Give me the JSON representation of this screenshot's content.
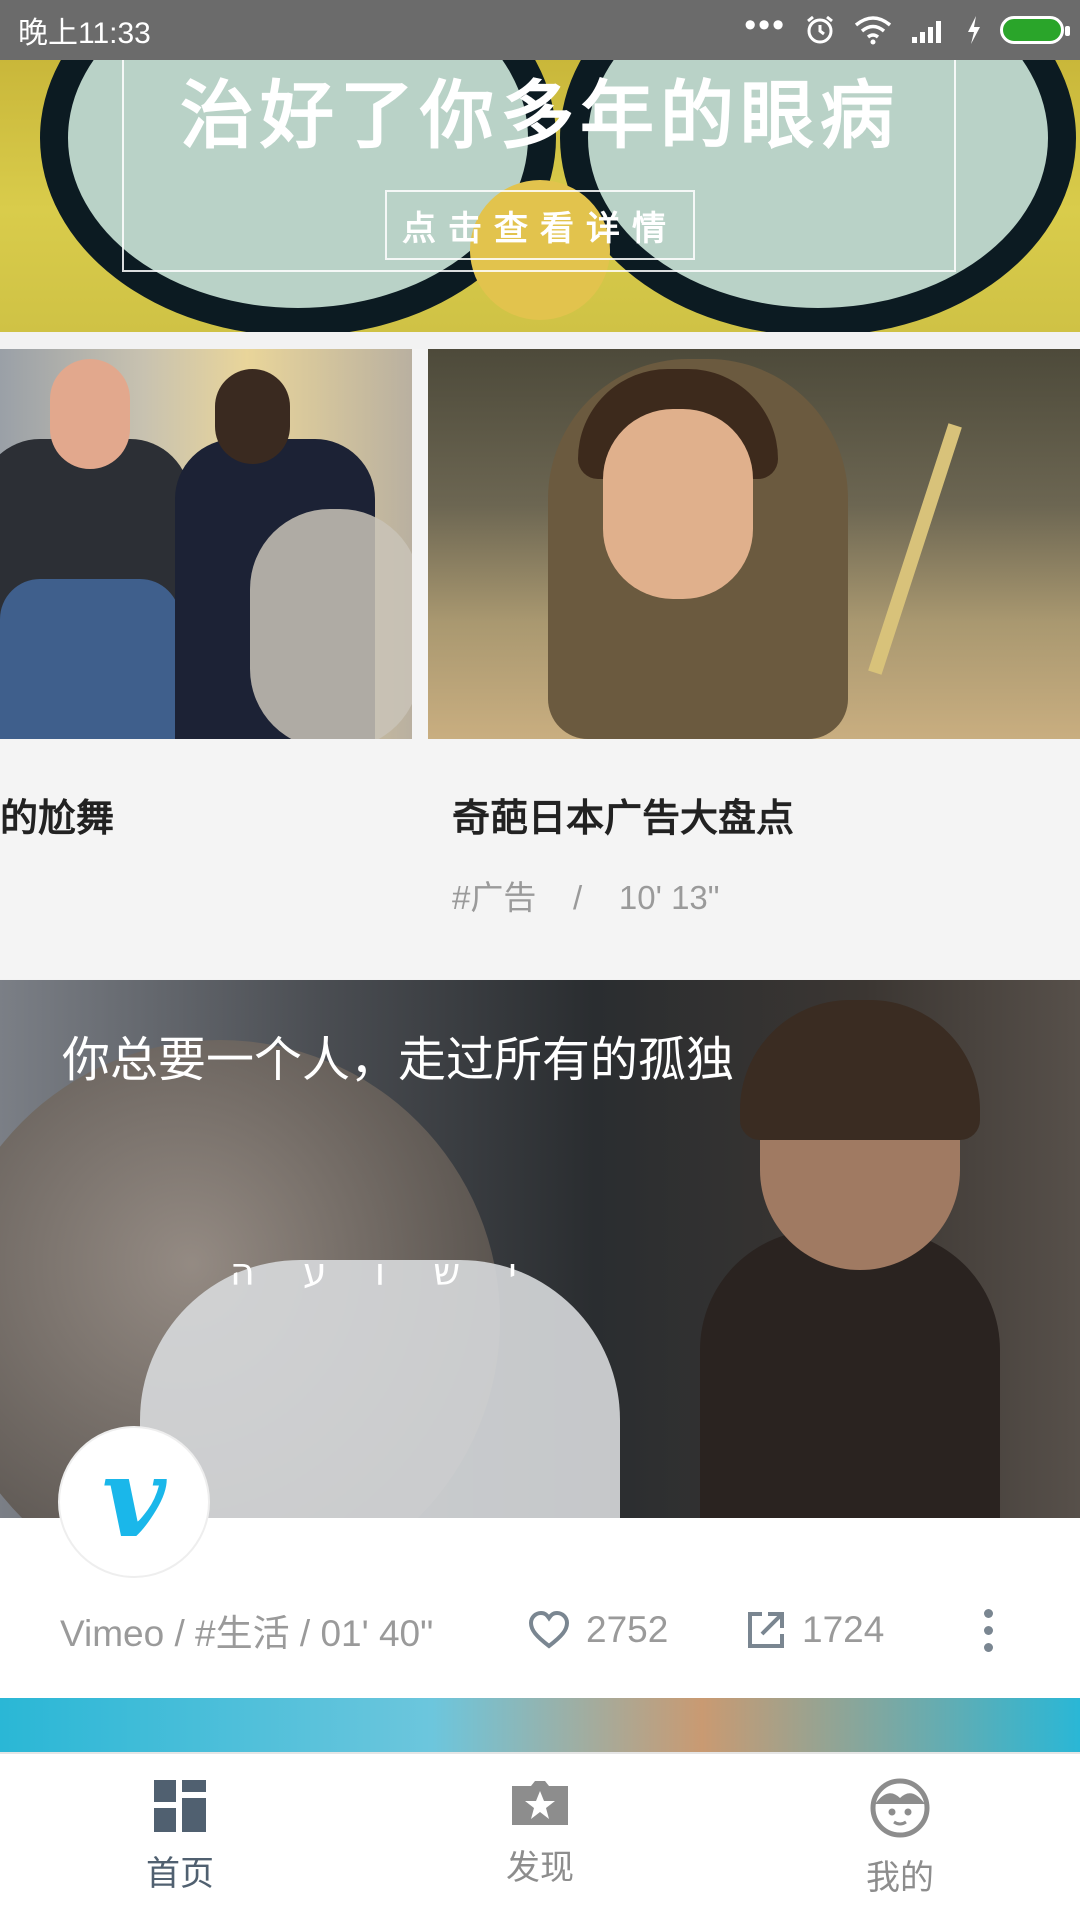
{
  "status_bar": {
    "time": "晚上11:33",
    "dots": "•••"
  },
  "banner": {
    "title": "治好了你多年的眼病",
    "detail_button": "点击查看详情"
  },
  "cards": [
    {
      "title": "的尬舞"
    },
    {
      "title": "奇葩日本广告大盘点",
      "tag": "#广告",
      "separator": "/",
      "duration": "10' 13\""
    }
  ],
  "video": {
    "caption": "你总要一个人，走过所有的孤独",
    "overlay_text": "י ש ו ע ה",
    "avatar_letter": "v",
    "source": "Vimeo / #生活  / 01' 40\"",
    "likes": "2752",
    "shares": "1724"
  },
  "nav": [
    {
      "label": "首页",
      "icon": "home-grid-icon",
      "active": true
    },
    {
      "label": "发现",
      "icon": "star-folder-icon",
      "active": false
    },
    {
      "label": "我的",
      "icon": "face-icon",
      "active": false
    }
  ],
  "colors": {
    "accent": "#506070",
    "vimeo": "#1ab7ea",
    "status_bar": "#6b6b6b",
    "battery": "#2aa52a"
  }
}
